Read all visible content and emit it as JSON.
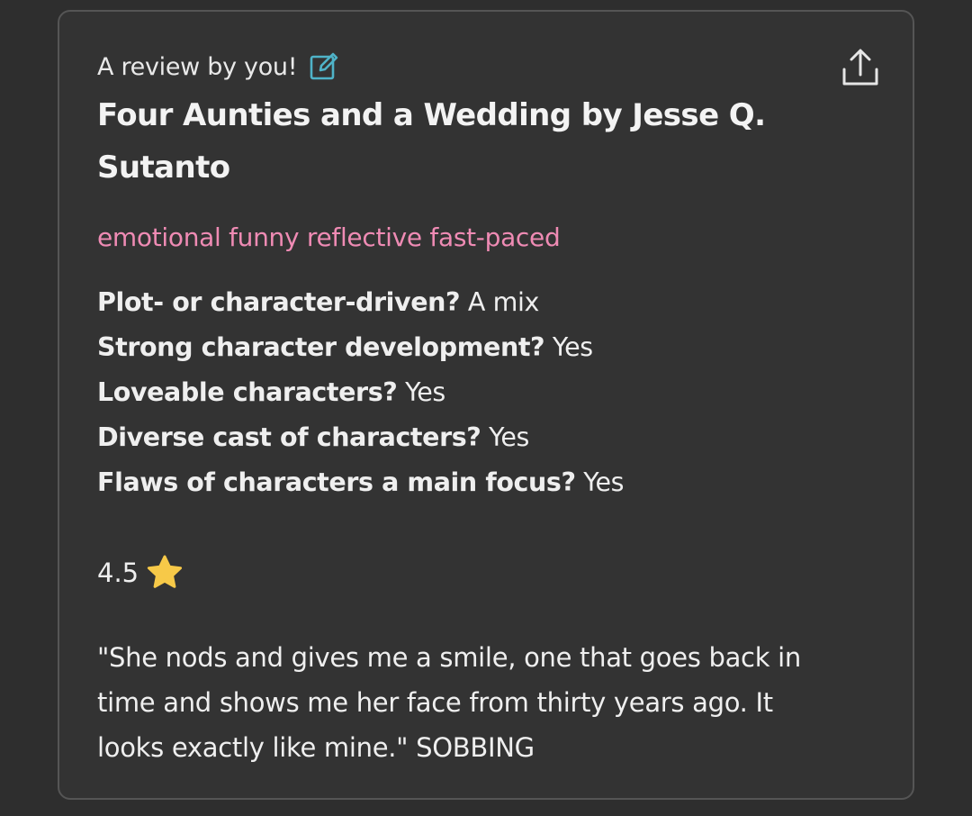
{
  "review": {
    "byline": "A review by you!",
    "edit_icon": "edit-icon",
    "share_icon": "share-upload-icon",
    "title": "Four Aunties and a Wedding by Jesse Q. Sutanto",
    "moods": "emotional funny reflective fast-paced",
    "questions": [
      {
        "q": "Plot- or character-driven?",
        "a": "A mix"
      },
      {
        "q": "Strong character development?",
        "a": "Yes"
      },
      {
        "q": "Loveable characters?",
        "a": "Yes"
      },
      {
        "q": "Diverse cast of characters?",
        "a": "Yes"
      },
      {
        "q": "Flaws of characters a main focus?",
        "a": "Yes"
      }
    ],
    "rating": "4.5",
    "rating_icon": "star-icon",
    "text": "\"She nods and gives me a smile, one that goes back in time and shows me her face from thirty years ago. It looks exactly like mine.\" SOBBING"
  },
  "colors": {
    "background": "#2e2e2e",
    "card": "#333333",
    "mood_text": "#ef8bb4",
    "edit_icon": "#4fb3c8",
    "star": "#f7c948"
  }
}
